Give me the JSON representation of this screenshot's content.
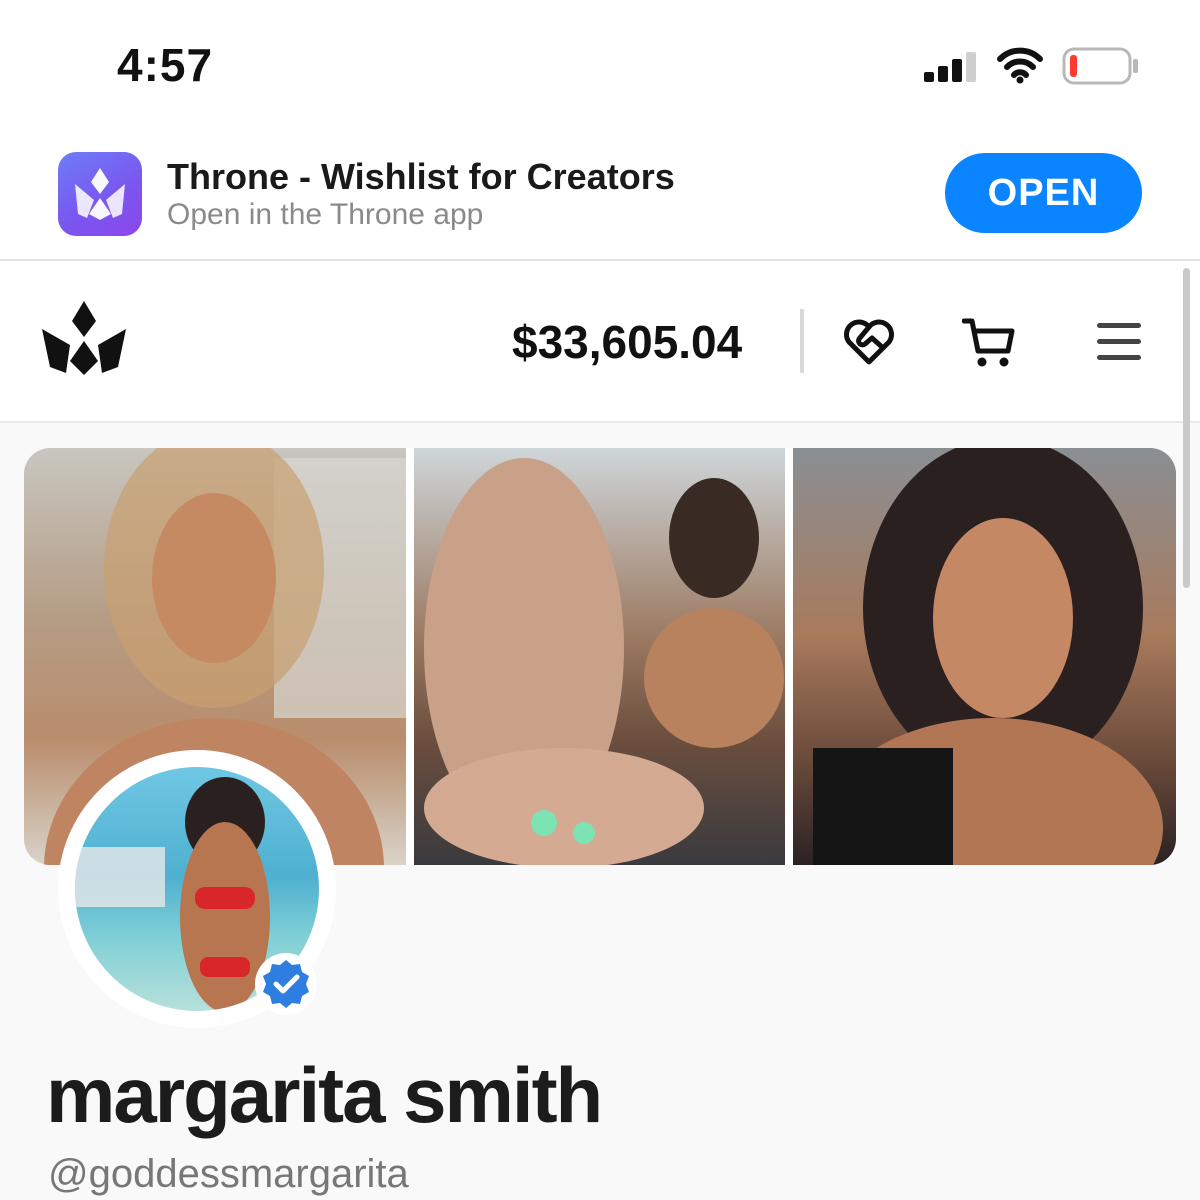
{
  "status_bar": {
    "time": "4:57",
    "icons": [
      "signal-icon",
      "wifi-icon",
      "battery-icon"
    ],
    "battery_level": 0.1
  },
  "app_banner": {
    "title": "Throne - Wishlist for Creators",
    "subtitle": "Open in the Throne app",
    "open_label": "OPEN",
    "icon": "throne-app-icon",
    "accent_color": "#0a84ff"
  },
  "header": {
    "logo": "throne-logo",
    "balance": "$33,605.04",
    "icons": [
      "heart-handshake-icon",
      "cart-icon",
      "menu-icon"
    ]
  },
  "cover_photos": [
    {
      "alt": "cover-photo-1"
    },
    {
      "alt": "cover-photo-2"
    },
    {
      "alt": "cover-photo-3"
    }
  ],
  "profile": {
    "name": "margarita smith",
    "handle": "@goddessmargarita",
    "verified": true,
    "verified_color": "#2e7de0"
  }
}
